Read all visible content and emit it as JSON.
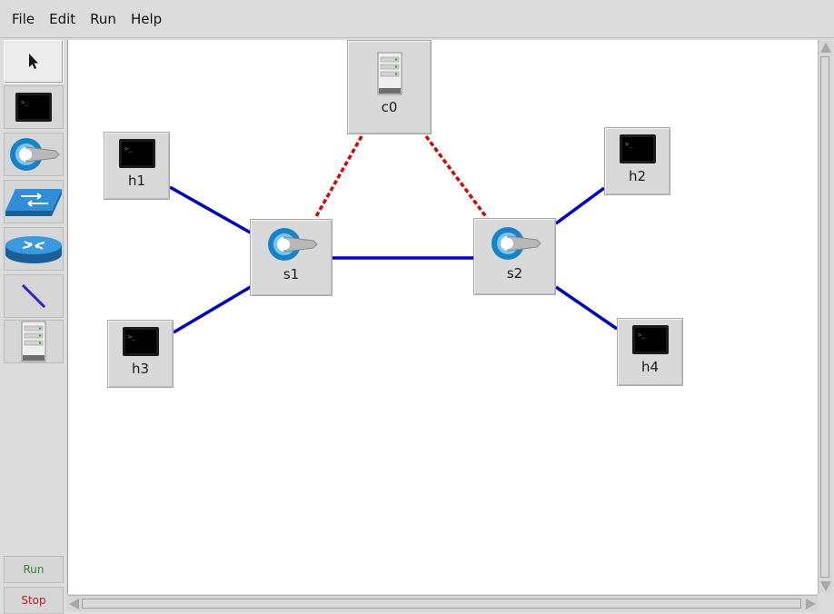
{
  "menu": {
    "items": [
      {
        "label": "File"
      },
      {
        "label": "Edit"
      },
      {
        "label": "Run"
      },
      {
        "label": "Help"
      }
    ]
  },
  "toolbar": {
    "tools": [
      {
        "name": "select-tool",
        "icon": "pointer-arrow-icon"
      },
      {
        "name": "host-tool",
        "icon": "host-terminal-icon"
      },
      {
        "name": "switch-tool",
        "icon": "openflow-switch-icon"
      },
      {
        "name": "legacy-switch-tool",
        "icon": "legacy-switch-icon"
      },
      {
        "name": "router-tool",
        "icon": "router-icon"
      },
      {
        "name": "link-tool",
        "icon": "netlink-icon"
      },
      {
        "name": "controller-tool",
        "icon": "controller-server-icon"
      }
    ],
    "run_label": "Run",
    "stop_label": "Stop",
    "run_color": "#2e8b2e",
    "stop_color": "#b22222"
  },
  "topology": {
    "nodes": {
      "c0": {
        "label": "c0",
        "type": "controller"
      },
      "h1": {
        "label": "h1",
        "type": "host"
      },
      "h2": {
        "label": "h2",
        "type": "host"
      },
      "h3": {
        "label": "h3",
        "type": "host"
      },
      "h4": {
        "label": "h4",
        "type": "host"
      },
      "s1": {
        "label": "s1",
        "type": "switch"
      },
      "s2": {
        "label": "s2",
        "type": "switch"
      }
    },
    "links": [
      {
        "from": "h1",
        "to": "s1",
        "kind": "data"
      },
      {
        "from": "h3",
        "to": "s1",
        "kind": "data"
      },
      {
        "from": "s1",
        "to": "s2",
        "kind": "data"
      },
      {
        "from": "s2",
        "to": "h2",
        "kind": "data"
      },
      {
        "from": "s2",
        "to": "h4",
        "kind": "data"
      },
      {
        "from": "c0",
        "to": "s1",
        "kind": "control"
      },
      {
        "from": "c0",
        "to": "s2",
        "kind": "control"
      }
    ],
    "colors": {
      "data_link": "#0000d0",
      "control_link": "#e00000"
    }
  }
}
